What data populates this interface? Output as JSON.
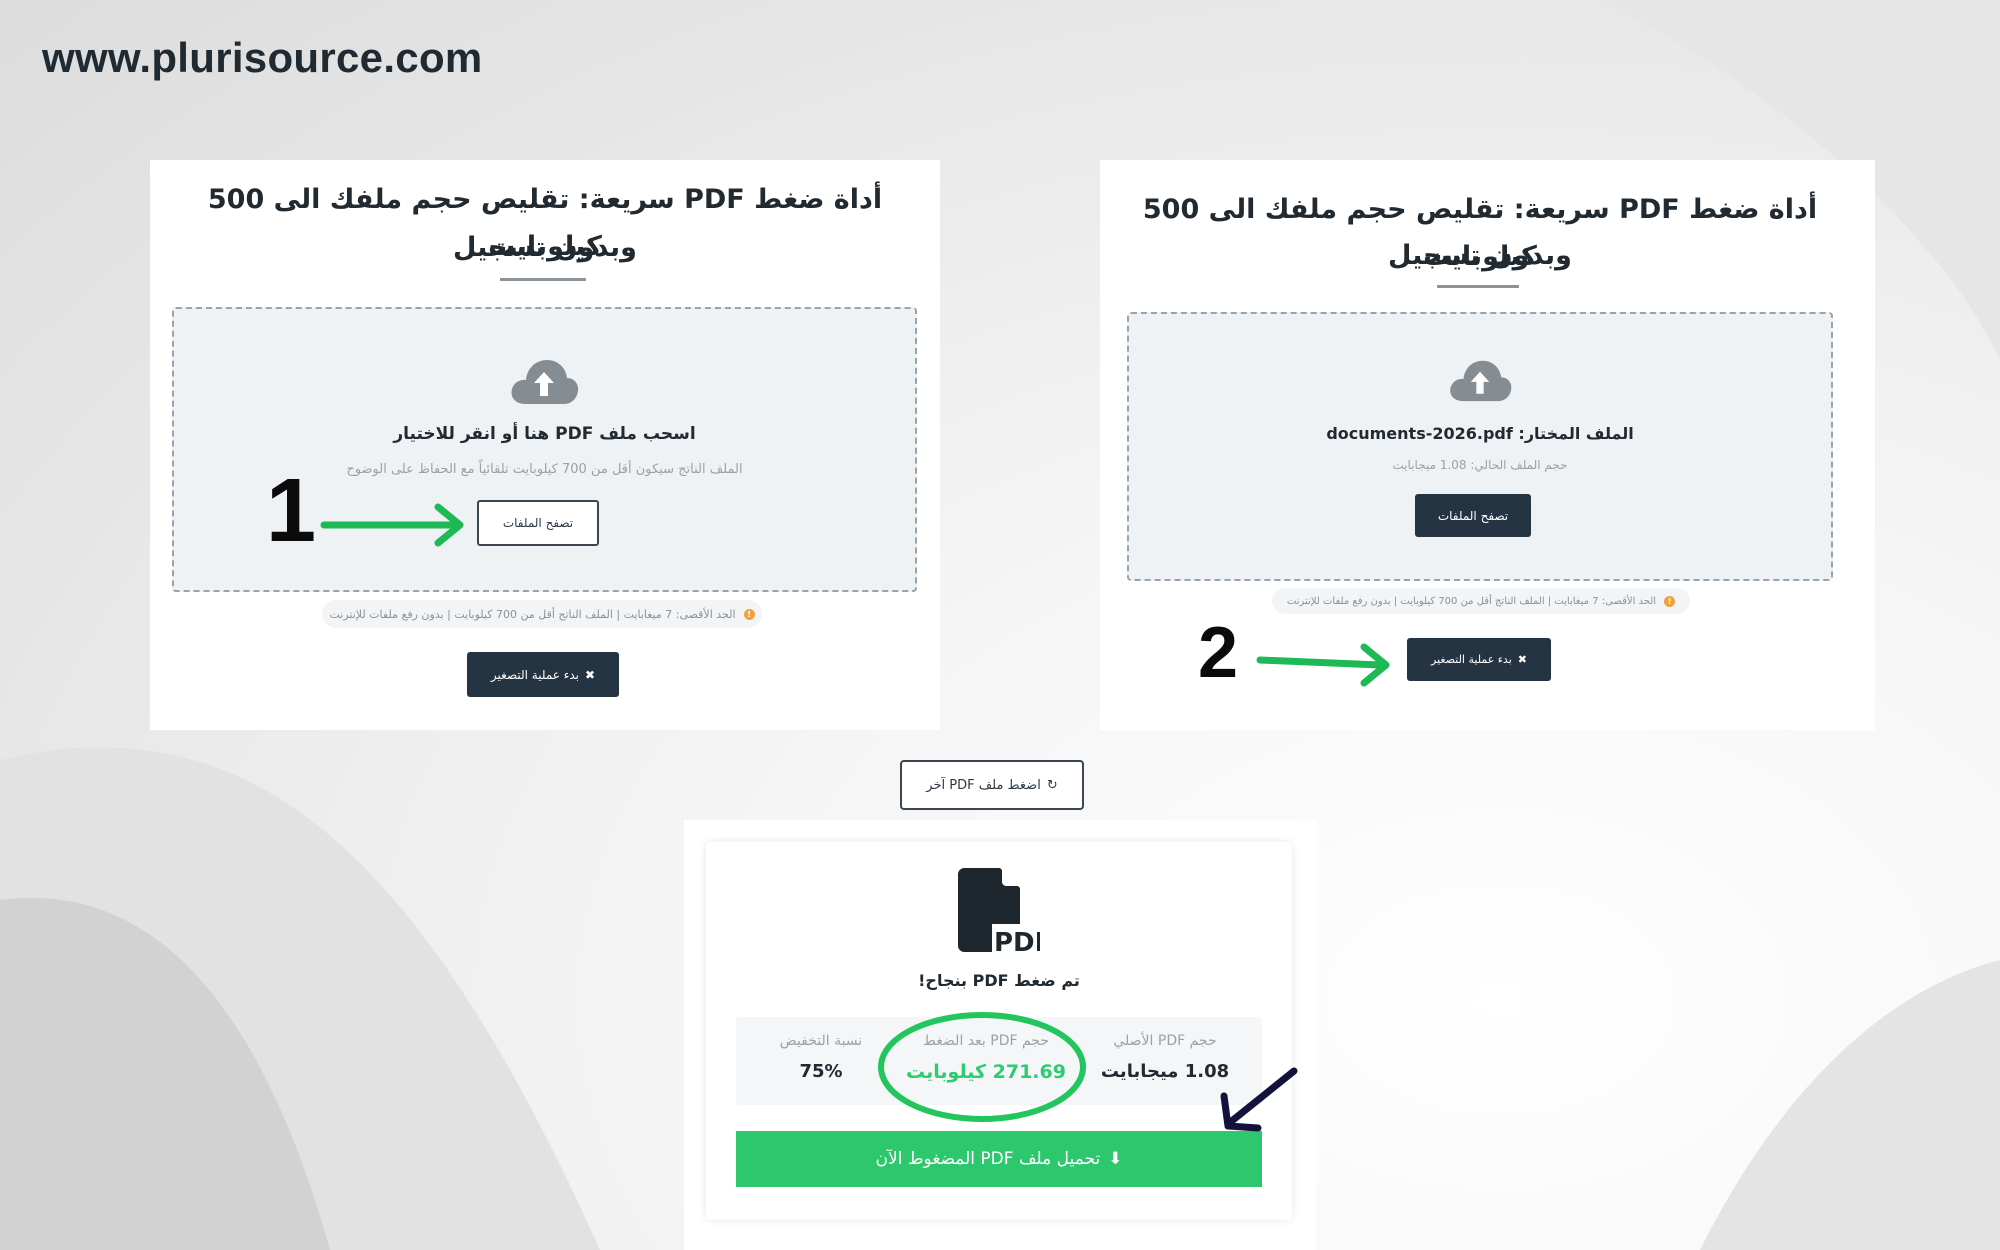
{
  "site": {
    "url": "www.plurisource.com"
  },
  "tool": {
    "title_line1": "أداة ضغط PDF سريعة: تقليص حجم ملفك الى 500 كيلوبايت",
    "title_line2": "وبدون تسجيل"
  },
  "step1": {
    "number": "1",
    "drop_main": "اسحب ملف PDF هنا أو انقر للاختيار",
    "drop_sub": "الملف الناتج سيكون أقل من 700 كيلوبايت تلقائياً مع الحفاظ على الوضوح",
    "browse_label": "تصفح الملفات",
    "info_text": "الحد الأقصى: 7 ميغابايت | الملف الناتج أقل من 700 كيلوبايت | بدون رفع ملفات للإنترنت",
    "start_label": "بدء عملية التصغير"
  },
  "step2": {
    "number": "2",
    "selected_file": "الملف المختار: documents-2026.pdf",
    "current_size": "حجم الملف الحالي: 1.08 ميجابايت",
    "browse_label": "تصفح الملفات",
    "info_text": "الحد الأقصى: 7 ميغابايت | الملف الناتج أقل من 700 كيلوبايت | بدون رفع ملفات للإنترنت",
    "start_label": "بدء عملية التصغير"
  },
  "result": {
    "compress_again_label": "اضغط ملف PDF آخر",
    "pdf_icon_text": "PDF",
    "success_text": "تم ضغط PDF بنجاح!",
    "original_label": "حجم PDF الأصلي",
    "original_value": "1.08 ميجابايت",
    "compressed_label": "حجم PDF بعد الضغط",
    "compressed_value": "271.69 كيلوبايت",
    "reduction_label": "نسبة التخفيض",
    "reduction_value": "75%",
    "download_label": "تحميل ملف PDF المضغوط الآن"
  },
  "colors": {
    "dark_button": "#253442",
    "green_accent": "#2ecc71",
    "annotation_arrow": "#1db954",
    "pointer_arrow": "#12123a",
    "info_dot": "#f0a23a"
  }
}
